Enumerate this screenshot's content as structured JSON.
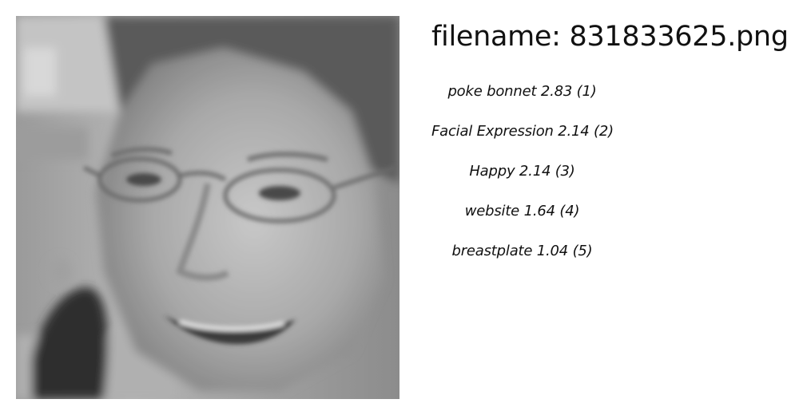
{
  "image": {
    "alt": "grayscale face crop"
  },
  "filename_text": "filename: 831833625.png",
  "labels": [
    {
      "text": "poke bonnet  2.83 (1)"
    },
    {
      "text": "Facial Expression  2.14 (2)"
    },
    {
      "text": "Happy  2.14 (3)"
    },
    {
      "text": "website  1.64 (4)"
    },
    {
      "text": "breastplate  1.04 (5)"
    }
  ]
}
